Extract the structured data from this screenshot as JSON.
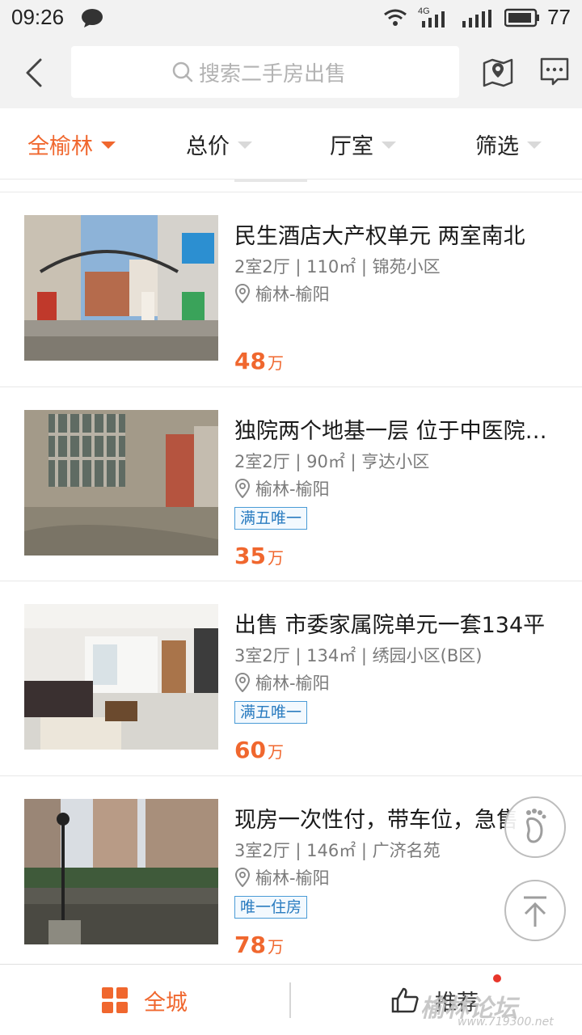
{
  "status_bar": {
    "time": "09:26",
    "network": "4G",
    "battery": "77"
  },
  "header": {
    "search_placeholder": "搜索二手房出售"
  },
  "filters": [
    {
      "label": "全榆林",
      "active": true
    },
    {
      "label": "总价",
      "active": false
    },
    {
      "label": "厅室",
      "active": false
    },
    {
      "label": "筛选",
      "active": false
    }
  ],
  "listings": [
    {
      "title": "民生酒店大产权单元 两室南北",
      "specs": "2室2厅 | 110㎡ | 锦苑小区",
      "location": "榆林-榆阳",
      "tag": "",
      "price": "48",
      "price_unit": "万"
    },
    {
      "title": "独院两个地基一层 位于中医院附近",
      "specs": "2室2厅 | 90㎡ | 亨达小区",
      "location": "榆林-榆阳",
      "tag": "满五唯一",
      "price": "35",
      "price_unit": "万"
    },
    {
      "title": "出售 市委家属院单元一套134平",
      "specs": "3室2厅 | 134㎡ | 绣园小区(B区)",
      "location": "榆林-榆阳",
      "tag": "满五唯一",
      "price": "60",
      "price_unit": "万"
    },
    {
      "title": "现房一次性付，带车位，急售",
      "specs": "3室2厅 | 146㎡ | 广济名苑",
      "location": "榆林-榆阳",
      "tag": "唯一住房",
      "price": "78",
      "price_unit": "万"
    }
  ],
  "tabbar": {
    "city_label": "全城",
    "recommend_label": "推荐"
  },
  "watermark": {
    "text": "榆林论坛",
    "url": "www.719300.net"
  },
  "colors": {
    "accent": "#f0672e",
    "tag_blue": "#2a7cc0",
    "background": "#f2f2f2"
  }
}
